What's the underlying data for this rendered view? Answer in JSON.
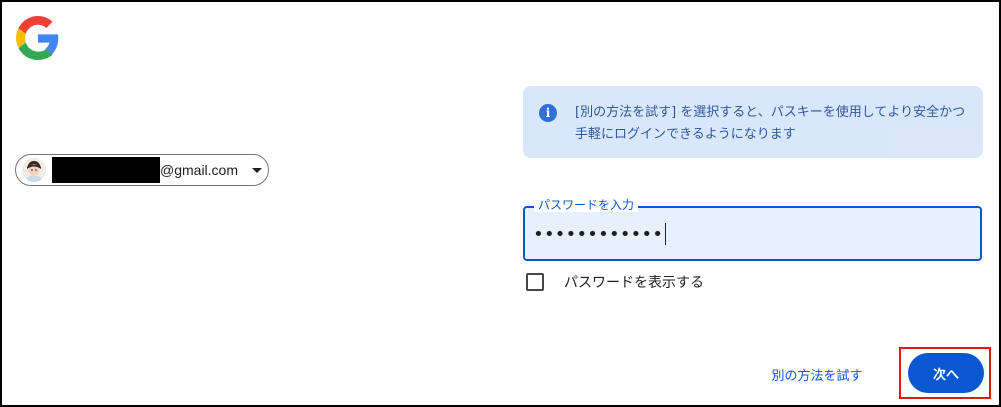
{
  "logo": {
    "icon": "google-g-logo",
    "colors": [
      "#4285F4",
      "#EA4335",
      "#FBBC05",
      "#34A853"
    ]
  },
  "account": {
    "avatar_icon": "user-avatar",
    "email_domain": "@gmail.com",
    "dropdown_icon": "chevron-down-icon"
  },
  "info": {
    "icon": "info-icon",
    "icon_glyph": "i",
    "text": "[別の方法を試す] を選択すると、パスキーを使用してより安全かつ手軽にログインできるようになります"
  },
  "password": {
    "label": "パスワードを入力",
    "value": "••••••••••••"
  },
  "show_password": {
    "label": "パスワードを表示する",
    "checked": false
  },
  "actions": {
    "try_another": "別の方法を試す",
    "next": "次へ"
  },
  "colors": {
    "primary": "#0b57d0",
    "info_bg": "#d3e3fd",
    "field_bg": "#e8f0fe",
    "highlight": "#e01818"
  }
}
